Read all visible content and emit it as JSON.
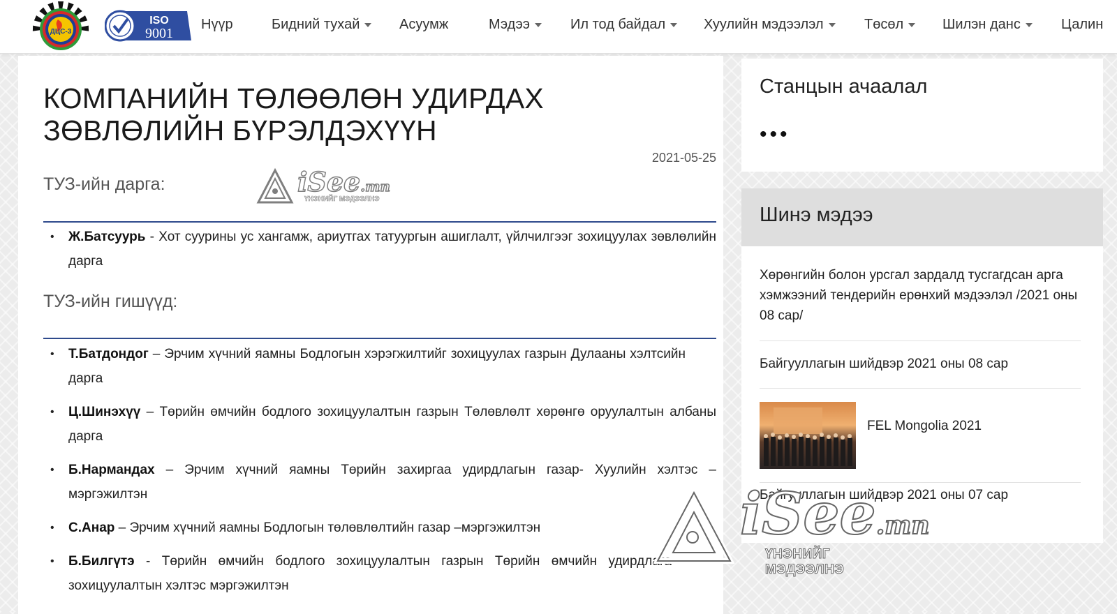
{
  "header": {
    "logo_text": "ДЦС-3",
    "iso_text": "ISO",
    "iso_number": "9001",
    "nav": [
      {
        "label": "Нүүр",
        "dropdown": false
      },
      {
        "label": "Бидний тухай",
        "dropdown": true
      },
      {
        "label": "Асуумж",
        "dropdown": false
      },
      {
        "label": "Мэдээ",
        "dropdown": true
      },
      {
        "label": "Ил тод байдал",
        "dropdown": true
      },
      {
        "label": "Хуулийн мэдээлэл",
        "dropdown": true
      },
      {
        "label": "Төсөл",
        "dropdown": true
      },
      {
        "label": "Шилэн данс",
        "dropdown": true
      },
      {
        "label": "Цалин",
        "dropdown": false
      }
    ]
  },
  "article": {
    "title": "КОМПАНИЙН ТӨЛӨӨЛӨН УДИРДАХ ЗӨВЛӨЛИЙН БҮРЭЛДЭХҮҮН",
    "date": "2021-05-25",
    "chair_heading": "ТУЗ-ийн дарга:",
    "chair": [
      {
        "name": "Ж.Батсуурь",
        "separator": " - ",
        "text": "Хот суурины ус хангамж, ариутгах татуургын ашиглалт, үйлчилгээг зохицуулах зөвлөлийн дарга"
      }
    ],
    "members_heading": "ТУЗ-ийн гишүүд:",
    "members": [
      {
        "name": "Т.Батдондог",
        "separator": " – ",
        "text": "Эрчим хүчний яамны  Бодлогын хэрэгжилтийг зохицуулах газрын Дулааны хэлтсийн дарга"
      },
      {
        "name": "Ц.Шинэхүү",
        "separator": " – ",
        "text": "Төрийн өмчийн бодлого зохицуулалтын газрын Төлөвлөлт хөрөнгө оруулалтын албаны дарга"
      },
      {
        "name": "Б.Нармандах",
        "separator": " – ",
        "text": "Эрчим хүчний яамны Төрийн захиргаа удирдлагын газар-  Хуулийн хэлтэс – мэргэжилтэн"
      },
      {
        "name": "С.Анар",
        "separator": " – ",
        "text": "Эрчим хүчний яамны  Бодлогын төлөвлөлтийн газар –мэргэжилтэн"
      },
      {
        "name": "Б.Билгүтэ",
        "separator": " - ",
        "text": "Төрийн өмчийн бодлого зохицуулалтын газрын  Төрийн өмчийн удирдлага зохицуулалтын  хэлтэс мэргэжилтэн"
      }
    ]
  },
  "sidebar": {
    "station": {
      "title": "Станцын ачаалал",
      "loading": "•••"
    },
    "news": {
      "title": "Шинэ мэдээ",
      "items": [
        {
          "text": "Хөрөнгийн болон урсгал зардалд тусгагдсан арга хэмжээний тендерийн ерөнхий мэдээлэл /2021 оны 08 сар/"
        },
        {
          "text": "Байгууллагын шийдвэр 2021 оны 08 сар"
        },
        {
          "text": "FEL Mongolia 2021"
        },
        {
          "text": "Байгууллагын шийдвэр 2021 оны 07 сар"
        }
      ]
    }
  },
  "watermark": {
    "brand": "iSee",
    "domain": ".mn",
    "tagline": "ҮНЭНИЙГ МЭДЭЭЛНЭ"
  }
}
